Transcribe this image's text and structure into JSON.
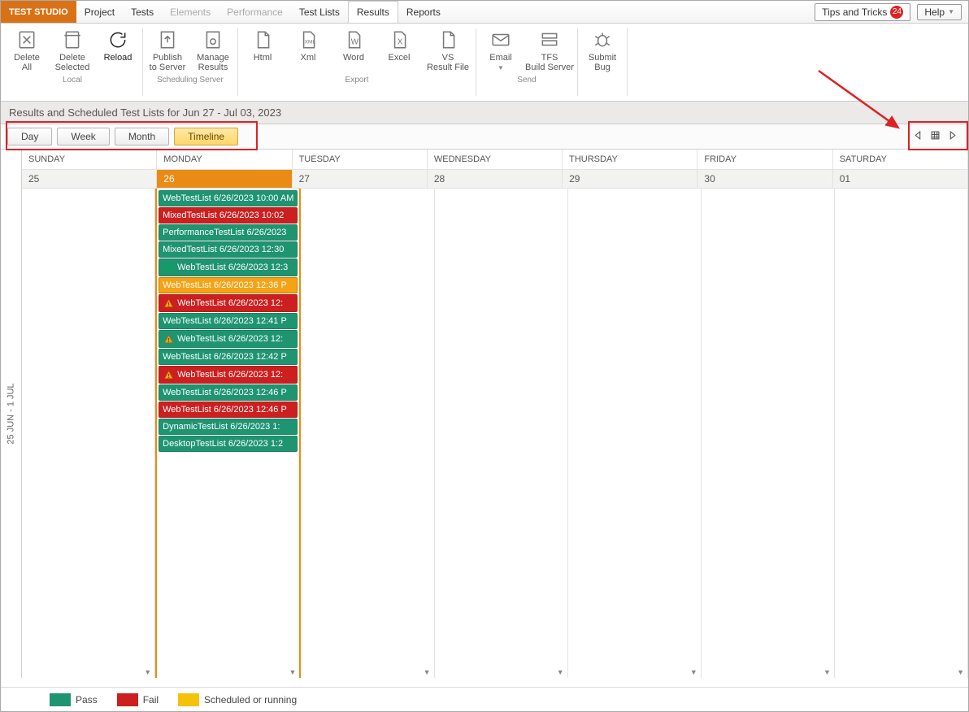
{
  "brand": "TEST STUDIO",
  "menu": {
    "project": "Project",
    "tests": "Tests",
    "elements": "Elements",
    "performance": "Performance",
    "testlists": "Test Lists",
    "results": "Results",
    "reports": "Reports"
  },
  "top_right": {
    "tips": "Tips and Tricks",
    "tips_badge": "24",
    "help": "Help"
  },
  "ribbon": {
    "delete_all": "Delete\nAll",
    "delete_selected": "Delete\nSelected",
    "reload": "Reload",
    "group_local": "Local",
    "publish": "Publish\nto Server",
    "manage": "Manage\nResults",
    "group_scheduling": "Scheduling Server",
    "html": "Html",
    "xml": "Xml",
    "word": "Word",
    "excel": "Excel",
    "vsresult": "VS\nResult File",
    "group_export": "Export",
    "email": "Email",
    "tfs": "TFS\nBuild Server",
    "group_send": "Send",
    "submit": "Submit\nBug"
  },
  "results_header": "Results and Scheduled Test Lists for Jun 27 - Jul 03, 2023",
  "views": {
    "day": "Day",
    "week": "Week",
    "month": "Month",
    "timeline": "Timeline"
  },
  "side_label": "25 JUN - 1 JUL",
  "day_headers": [
    "SUNDAY",
    "MONDAY",
    "TUESDAY",
    "WEDNESDAY",
    "THURSDAY",
    "FRIDAY",
    "SATURDAY"
  ],
  "dates": [
    "25",
    "26",
    "27",
    "28",
    "29",
    "30",
    "01"
  ],
  "today_date": "26",
  "events_monday": [
    {
      "status": "pass",
      "icon": "",
      "label": "WebTestList 6/26/2023 10:00 AM"
    },
    {
      "status": "fail",
      "icon": "",
      "label": "MixedTestList 6/26/2023 10:02"
    },
    {
      "status": "pass",
      "icon": "",
      "label": "PerformanceTestList 6/26/2023"
    },
    {
      "status": "pass",
      "icon": "",
      "label": "MixedTestList 6/26/2023 12:30"
    },
    {
      "status": "pass",
      "icon": "clock",
      "label": "WebTestList 6/26/2023 12:3"
    },
    {
      "status": "sched",
      "icon": "",
      "label": "WebTestList 6/26/2023 12:36 P"
    },
    {
      "status": "fail",
      "icon": "warn",
      "label": "WebTestList 6/26/2023 12:"
    },
    {
      "status": "pass",
      "icon": "",
      "label": "WebTestList 6/26/2023 12:41 P"
    },
    {
      "status": "pass",
      "icon": "warn",
      "label": "WebTestList 6/26/2023 12:"
    },
    {
      "status": "pass",
      "icon": "",
      "label": "WebTestList 6/26/2023 12:42 P"
    },
    {
      "status": "fail",
      "icon": "warn",
      "label": "WebTestList 6/26/2023 12:"
    },
    {
      "status": "pass",
      "icon": "",
      "label": "WebTestList 6/26/2023 12:46 P"
    },
    {
      "status": "fail",
      "icon": "",
      "label": "WebTestList 6/26/2023 12:46 P"
    },
    {
      "status": "pass",
      "icon": "",
      "label": "DynamicTestList 6/26/2023 1:"
    },
    {
      "status": "pass",
      "icon": "",
      "label": "DesktopTestList 6/26/2023 1:2"
    }
  ],
  "legend": {
    "pass": "Pass",
    "fail": "Fail",
    "sched": "Scheduled or running"
  }
}
